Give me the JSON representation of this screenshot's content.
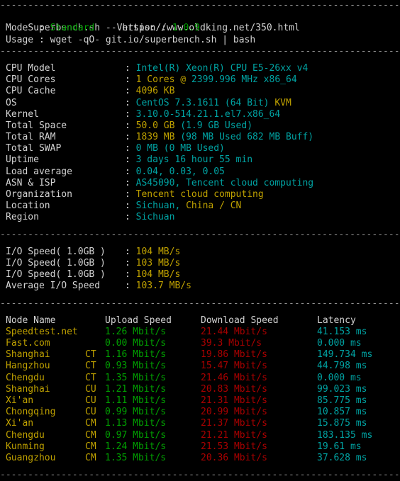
{
  "terminal": {
    "separator": "-------------------------------------------------------------------------",
    "colors": {
      "background": "#000000",
      "label": "#d3d3d3",
      "cyan": "#00a3a3",
      "yellow": "#bfa100",
      "green": "#00a000",
      "red": "#aa0000",
      "separator": "#909090"
    }
  },
  "header": {
    "title": "Superbench.sh -- https://www.oldking.net/350.html",
    "mode_label": "Mode",
    "mode_value": "Standard",
    "version_label": "Version",
    "version_value": "1.0.9",
    "usage_label": "Usage",
    "usage_value": "wget -qO- git.io/superbench.sh | bash"
  },
  "sysinfo": [
    {
      "label": "CPU Model",
      "value": "Intel(R) Xeon(R) CPU E5-26xx v4",
      "value_color": "cyan"
    },
    {
      "label": "CPU Cores",
      "value": "1 Cores @",
      "value_color": "yellow",
      "value2": " 2399.996 MHz x86_64",
      "value2_color": "cyan"
    },
    {
      "label": "CPU Cache",
      "value": "4096 KB",
      "value_color": "yellow"
    },
    {
      "label": "OS",
      "value": "CentOS 7.3.1611 (64 Bit)",
      "value_color": "cyan",
      "value2": " KVM",
      "value2_color": "yellow"
    },
    {
      "label": "Kernel",
      "value": "3.10.0-514.21.1.el7.x86_64",
      "value_color": "cyan"
    },
    {
      "label": "Total Space",
      "value": "50.0 GB",
      "value_color": "yellow",
      "value2": " (1.9 GB Used)",
      "value2_color": "cyan"
    },
    {
      "label": "Total RAM",
      "value": "1839 MB",
      "value_color": "yellow",
      "value2": " (98 MB Used 682 MB Buff)",
      "value2_color": "cyan"
    },
    {
      "label": "Total SWAP",
      "value": "0 MB (0 MB Used)",
      "value_color": "cyan"
    },
    {
      "label": "Uptime",
      "value": "3 days 16 hour 55 min",
      "value_color": "cyan"
    },
    {
      "label": "Load average",
      "value": "0.04, 0.03, 0.05",
      "value_color": "cyan"
    },
    {
      "label": "ASN & ISP",
      "value": "AS45090, Tencent cloud computing",
      "value_color": "cyan"
    },
    {
      "label": "Organization",
      "value": "Tencent cloud computing",
      "value_color": "yellow"
    },
    {
      "label": "Location",
      "value": "Sichuan,",
      "value_color": "cyan",
      "value2": " China / CN",
      "value2_color": "yellow"
    },
    {
      "label": "Region",
      "value": "Sichuan",
      "value_color": "cyan"
    }
  ],
  "iospeed": [
    {
      "label": "I/O Speed( 1.0GB )",
      "value": "104 MB/s"
    },
    {
      "label": "I/O Speed( 1.0GB )",
      "value": "103 MB/s"
    },
    {
      "label": "I/O Speed( 1.0GB )",
      "value": "104 MB/s"
    },
    {
      "label": "Average I/O Speed",
      "value": "103.7 MB/s"
    }
  ],
  "speedtest": {
    "columns": [
      "Node Name",
      "Upload Speed",
      "Download Speed",
      "Latency"
    ],
    "rows": [
      {
        "name": "Speedtest.net",
        "isp": "",
        "upload": "1.26 Mbit/s",
        "download": "21.44 Mbit/s",
        "latency": "41.153 ms"
      },
      {
        "name": "Fast.com",
        "isp": "",
        "upload": "0.00 Mbit/s",
        "download": "39.3 Mbit/s",
        "latency": "0.000 ms"
      },
      {
        "name": "Shanghai",
        "isp": "CT",
        "upload": "1.16 Mbit/s",
        "download": "19.86 Mbit/s",
        "latency": "149.734 ms"
      },
      {
        "name": "Hangzhou",
        "isp": "CT",
        "upload": "0.93 Mbit/s",
        "download": "15.47 Mbit/s",
        "latency": "44.798 ms"
      },
      {
        "name": "Chengdu",
        "isp": "CT",
        "upload": "1.35 Mbit/s",
        "download": "21.46 Mbit/s",
        "latency": "0.000 ms"
      },
      {
        "name": "Shanghai",
        "isp": "CU",
        "upload": "1.21 Mbit/s",
        "download": "20.83 Mbit/s",
        "latency": "99.023 ms"
      },
      {
        "name": "Xi'an",
        "isp": "CU",
        "upload": "1.11 Mbit/s",
        "download": "21.31 Mbit/s",
        "latency": "85.775 ms"
      },
      {
        "name": "Chongqing",
        "isp": "CU",
        "upload": "0.99 Mbit/s",
        "download": "20.99 Mbit/s",
        "latency": "10.857 ms"
      },
      {
        "name": "Xi'an",
        "isp": "CM",
        "upload": "1.13 Mbit/s",
        "download": "21.37 Mbit/s",
        "latency": "15.875 ms"
      },
      {
        "name": "Chengdu",
        "isp": "CM",
        "upload": "0.97 Mbit/s",
        "download": "21.21 Mbit/s",
        "latency": "183.135 ms"
      },
      {
        "name": "Kunming",
        "isp": "CM",
        "upload": "1.24 Mbit/s",
        "download": "21.53 Mbit/s",
        "latency": "19.61 ms"
      },
      {
        "name": "Guangzhou",
        "isp": "CM",
        "upload": "1.35 Mbit/s",
        "download": "20.36 Mbit/s",
        "latency": "37.628 ms"
      }
    ]
  }
}
